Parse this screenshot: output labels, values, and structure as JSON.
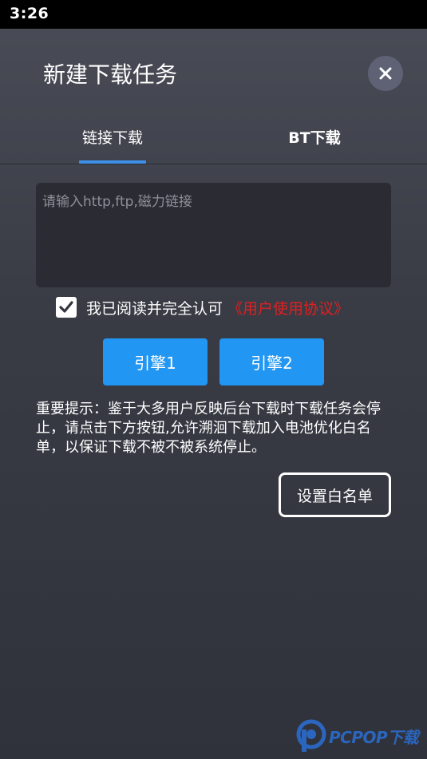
{
  "status_bar": {
    "time": "3:26"
  },
  "dialog": {
    "title": "新建下载任务",
    "tabs": [
      {
        "label": "链接下载",
        "active": true
      },
      {
        "label": "BT下载",
        "active": false
      }
    ]
  },
  "url_input": {
    "placeholder": "请输入http,ftp,磁力链接",
    "value": ""
  },
  "agreement": {
    "checked": true,
    "text": "我已阅读并完全认可",
    "link_label": "《用户使用协议》"
  },
  "engines": [
    {
      "label": "引擎1"
    },
    {
      "label": "引擎2"
    }
  ],
  "notice": "重要提示：鉴于大多用户反映后台下载时下载任务会停止，请点击下方按钮,允许溯洄下载加入电池优化白名单，以保证下载不被不被系统停止。",
  "whitelist_button": {
    "label": "设置白名单"
  },
  "watermark": {
    "text": "PCPOP下载"
  },
  "colors": {
    "accent": "#2196f3",
    "tab_indicator": "#3d8fe8",
    "link_red": "#e02020",
    "close_bg": "#5f6275"
  }
}
